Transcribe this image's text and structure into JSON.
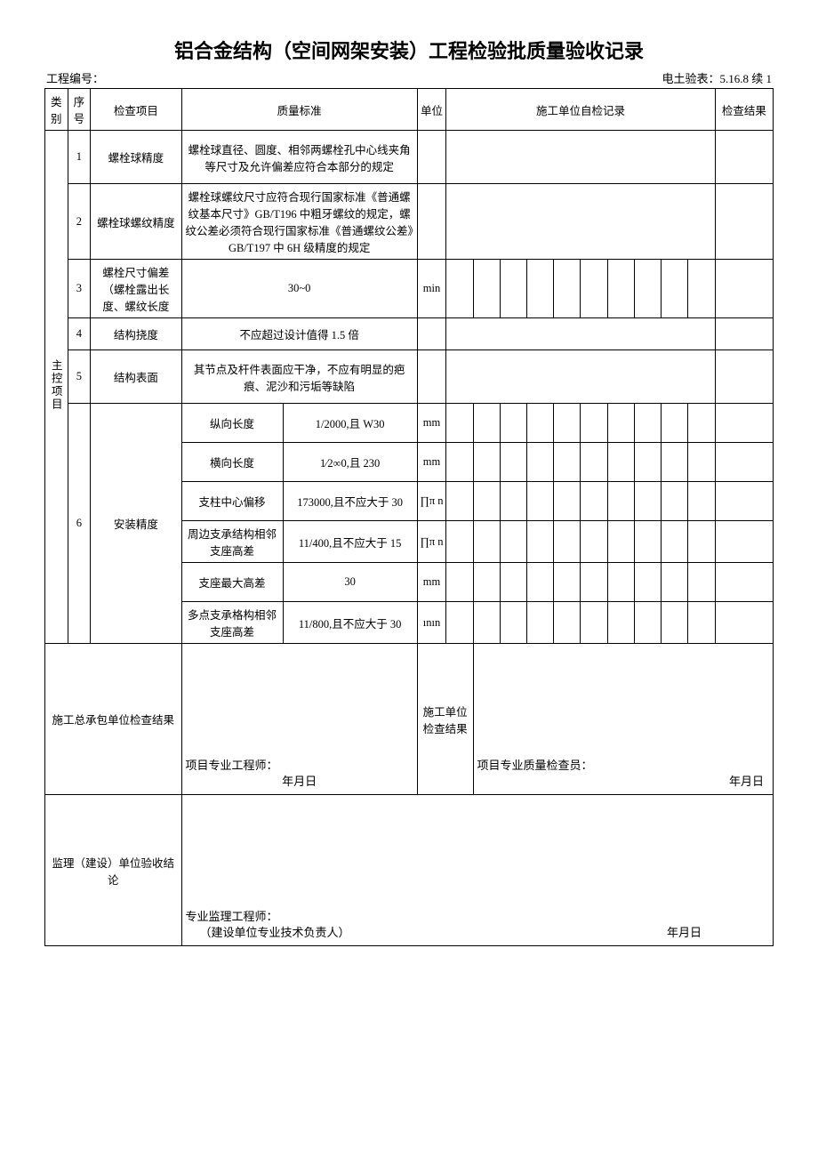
{
  "title": "铝合金结构（空间网架安装）工程检验批质量验收记录",
  "meta": {
    "proj_no_label": "工程编号：",
    "form_no_label": "电土验表：5.16.8 续 1"
  },
  "headers": {
    "category": "类别",
    "seq": "序号",
    "item": "检查项目",
    "standard": "质量标准",
    "unit": "单位",
    "self_check": "施工单位自检记录",
    "result": "检查结果"
  },
  "category_label": "主控项目",
  "rows": [
    {
      "seq": "1",
      "item": "螺栓球精度",
      "standard": "螺栓球直径、圆度、相邻两螺栓孔中心线夹角等尺寸及允许偏差应符合本部分的规定",
      "unit": ""
    },
    {
      "seq": "2",
      "item": "螺栓球螺纹精度",
      "standard": "螺栓球螺纹尺寸应符合现行国家标准《普通螺纹基本尺寸》GB/T196 中粗牙螺纹的规定，螺纹公差必须符合现行国家标准《普通螺纹公差》GB/T197 中 6H 级精度的规定",
      "unit": ""
    },
    {
      "seq": "3",
      "item": "螺栓尺寸偏差（螺栓露出长度、螺纹长度",
      "standard": "30~0",
      "unit": "min"
    },
    {
      "seq": "4",
      "item": "结构挠度",
      "standard": "不应超过设计值得 1.5 倍",
      "unit": ""
    },
    {
      "seq": "5",
      "item": "结构表面",
      "standard": "其节点及杆件表面应干净，不应有明显的疤痕、泥沙和污垢等缺陷",
      "unit": ""
    },
    {
      "seq": "6",
      "item": "安装精度",
      "sub": [
        {
          "label": "纵向长度",
          "value": "1/2000,且 W30",
          "unit": "mm"
        },
        {
          "label": "横向长度",
          "value": "1⁄2∞0,且 230",
          "unit": "mm"
        },
        {
          "label": "支柱中心偏移",
          "value": "173000,且不应大于 30",
          "unit": "∏π n"
        },
        {
          "label": "周边支承结构相邻支座高差",
          "value": "11/400,且不应大于 15",
          "unit": "∏π n"
        },
        {
          "label": "支座最大高差",
          "value": "30",
          "unit": "mm"
        },
        {
          "label": "多点支承格构相邻支座高差",
          "value": "11/800,且不应大于 30",
          "unit": "ının"
        }
      ]
    }
  ],
  "footer": {
    "contractor_result_label": "施工总承包单位检查结果",
    "unit_result_label": "施工单位检查结果",
    "engineer_label": "项目专业工程师：",
    "qc_label": "项目专业质量检查员：",
    "date_label": "年月日",
    "supervision_label": "监理（建设）单位验收结论",
    "supervisor_engineer": "专业监理工程师：",
    "owner_tech": "（建设单位专业技术负责人）"
  }
}
